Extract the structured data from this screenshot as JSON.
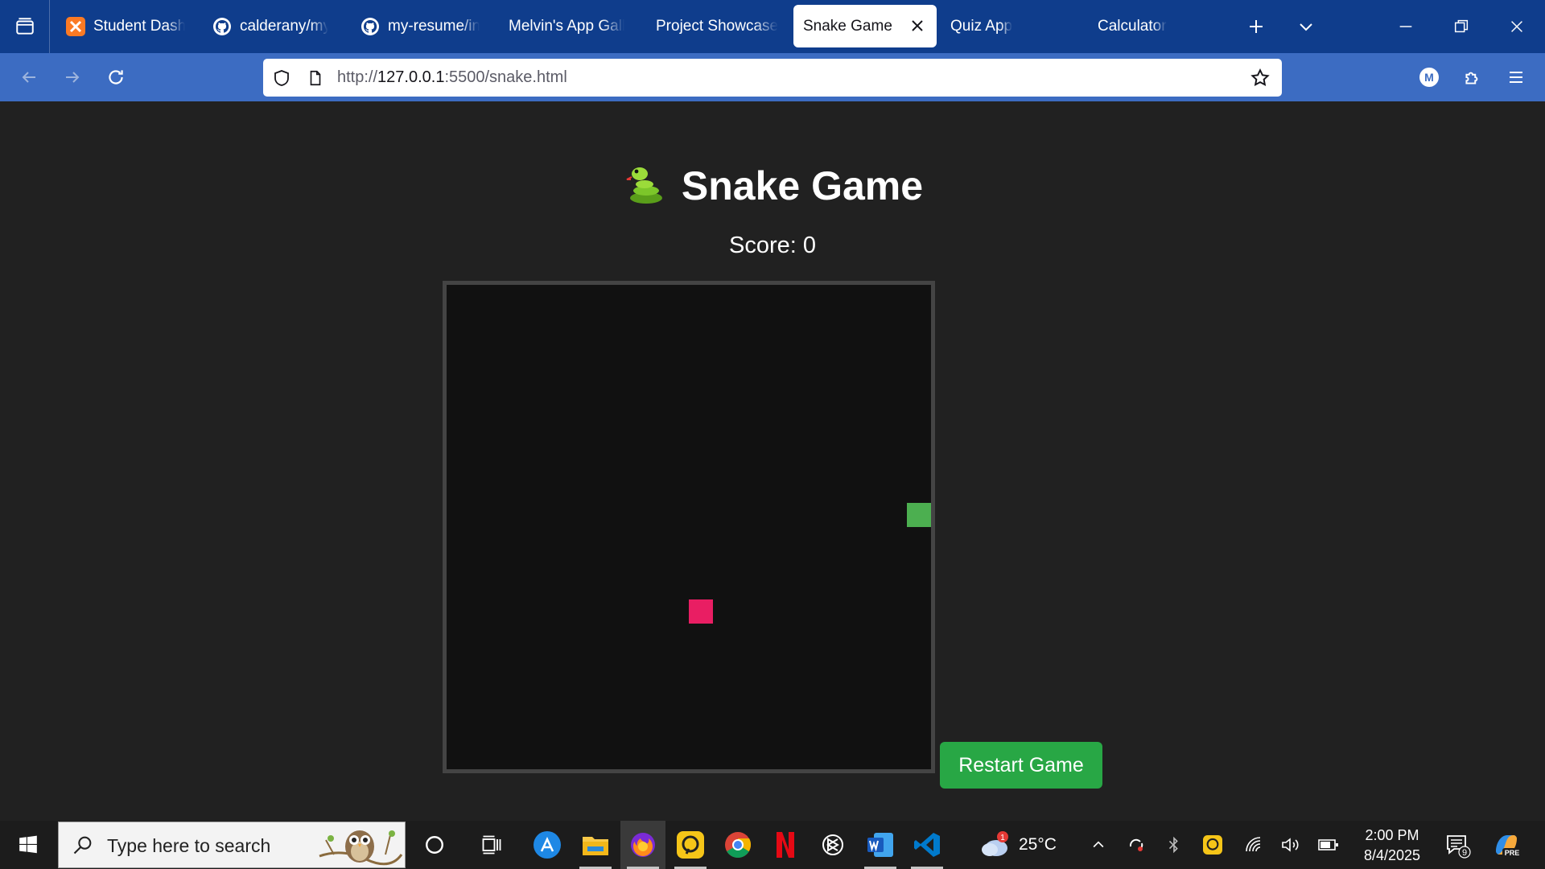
{
  "browser": {
    "tabs": [
      {
        "label": "Student Dashboard",
        "icon": "xampp-icon",
        "active": false
      },
      {
        "label": "calderany/my-resume",
        "icon": "github-icon",
        "active": false
      },
      {
        "label": "my-resume/index",
        "icon": "github-icon",
        "active": false
      },
      {
        "label": "Melvin's App Gallery",
        "icon": "",
        "active": false
      },
      {
        "label": "Project Showcase",
        "icon": "",
        "active": false
      },
      {
        "label": "Snake Game",
        "icon": "",
        "active": true
      },
      {
        "label": "Quiz App",
        "icon": "",
        "active": false
      },
      {
        "label": "Calculator",
        "icon": "",
        "active": false
      }
    ],
    "url": {
      "scheme": "http://",
      "host": "127.0.0.1",
      "rest": ":5500/snake.html"
    },
    "account_initial": "M"
  },
  "game": {
    "title": "Snake Game",
    "title_icon": "snake-emoji",
    "score_label": "Score: 0",
    "restart_label": "Restart Game",
    "grid": {
      "cols": 20,
      "rows": 20
    },
    "snake": [
      {
        "col": 19,
        "row": 9
      }
    ],
    "food": {
      "col": 10,
      "row": 13
    },
    "colors": {
      "snake": "#4caf50",
      "food": "#e91e63",
      "board": "#111111",
      "button": "#28a745"
    }
  },
  "taskbar": {
    "search_placeholder": "Type here to search",
    "weather": {
      "temp": "25°C",
      "alert_count": "1"
    },
    "clock": {
      "time": "2:00 PM",
      "date": "8/4/2025"
    },
    "notification_count": "9",
    "copilot_badge": "PRE"
  }
}
